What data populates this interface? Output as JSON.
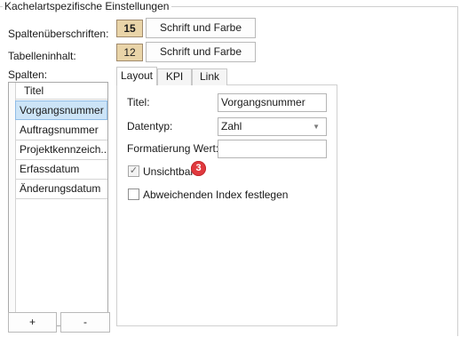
{
  "groupbox": {
    "title": "Kachelartspezifische Einstellungen"
  },
  "header_settings": {
    "label": "Spaltenüberschriften:",
    "size": "15",
    "button_label": "Schrift und Farbe"
  },
  "content_settings": {
    "label": "Tabelleninhalt:",
    "size": "12",
    "button_label": "Schrift und Farbe"
  },
  "columns": {
    "label": "Spalten:",
    "header": "Titel",
    "items": [
      {
        "label": "Vorgangsnummer",
        "selected": true
      },
      {
        "label": "Auftragsnummer",
        "selected": false
      },
      {
        "label": "Projektkennzeich...",
        "selected": false
      },
      {
        "label": "Erfassdatum",
        "selected": false
      },
      {
        "label": "Änderungsdatum",
        "selected": false
      }
    ],
    "add_label": "+",
    "remove_label": "-"
  },
  "tabs": [
    {
      "label": "Layout",
      "active": true
    },
    {
      "label": "KPI",
      "active": false
    },
    {
      "label": "Link",
      "active": false
    }
  ],
  "layout": {
    "title_label": "Titel:",
    "title_value": "Vorgangsnummer",
    "datatype_label": "Datentyp:",
    "datatype_value": "Zahl",
    "format_label": "Formatierung Wert:",
    "format_value": "",
    "invisible_label": "Unsichtbar",
    "invisible_checked": true,
    "invisible_badge": "3",
    "index_label": "Abweichenden Index festlegen",
    "index_checked": false
  },
  "icons": {
    "dropdown": "chevron-down-icon",
    "check": "checkmark-icon"
  },
  "colors": {
    "size_box_fill": "#e9d4a8",
    "selection": "#cce4f7",
    "badge": "#e0393e"
  }
}
